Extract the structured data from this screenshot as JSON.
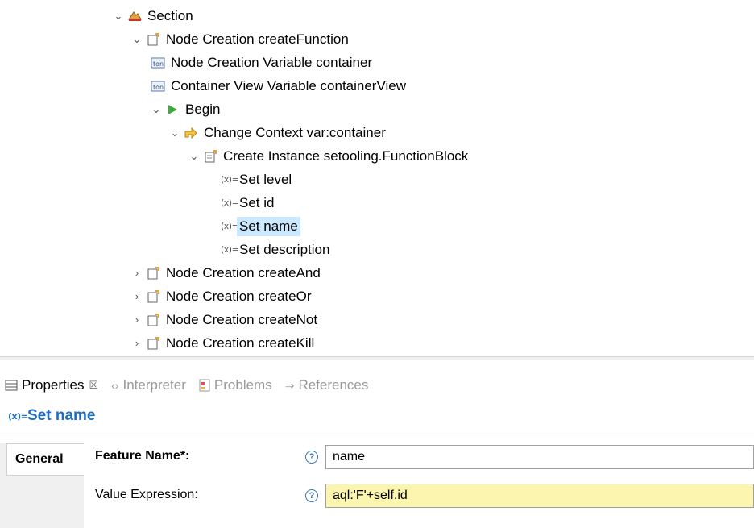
{
  "tree": {
    "items": [
      {
        "label": "Section",
        "icon": "section-icon",
        "expanded": true
      },
      {
        "label": "Node Creation createFunction",
        "icon": "node-creation-icon",
        "expanded": true
      },
      {
        "label": "Node Creation Variable container",
        "icon": "variable-icon"
      },
      {
        "label": "Container View Variable containerView",
        "icon": "variable-icon"
      },
      {
        "label": "Begin",
        "icon": "begin-play-icon",
        "expanded": true
      },
      {
        "label": "Change Context var:container",
        "icon": "change-context-icon",
        "expanded": true
      },
      {
        "label": "Create Instance setooling.FunctionBlock",
        "icon": "create-instance-icon",
        "expanded": true
      },
      {
        "label": "Set level",
        "icon": "set-value-icon"
      },
      {
        "label": "Set id",
        "icon": "set-value-icon"
      },
      {
        "label": "Set name",
        "icon": "set-value-icon",
        "selected": true
      },
      {
        "label": "Set description",
        "icon": "set-value-icon"
      },
      {
        "label": "Node Creation createAnd",
        "icon": "node-creation-icon",
        "expanded": false
      },
      {
        "label": "Node Creation createOr",
        "icon": "node-creation-icon",
        "expanded": false
      },
      {
        "label": "Node Creation createNot",
        "icon": "node-creation-icon",
        "expanded": false
      },
      {
        "label": "Node Creation createKill",
        "icon": "node-creation-icon",
        "expanded": false
      }
    ]
  },
  "tabs": [
    {
      "label": "Properties",
      "icon": "properties-icon",
      "active": true,
      "close": "☒"
    },
    {
      "label": "Interpreter",
      "icon": "interpreter-icon"
    },
    {
      "label": "Problems",
      "icon": "problems-icon"
    },
    {
      "label": "References",
      "icon": "references-icon"
    }
  ],
  "properties": {
    "title": "Set name",
    "section_tab": "General",
    "fields": [
      {
        "label": "Feature Name*:",
        "value": "name",
        "bold": true
      },
      {
        "label": "Value Expression:",
        "value": "aql:'F'+self.id",
        "highlight": true
      }
    ],
    "help_glyph": "?"
  },
  "glyphs": {
    "expanded": "⌄",
    "collapsed": "›",
    "set_value": "(x)="
  },
  "colors": {
    "selection": "#cce8ff",
    "title": "#1f6fbf",
    "expression_bg": "#fbf5b0"
  }
}
